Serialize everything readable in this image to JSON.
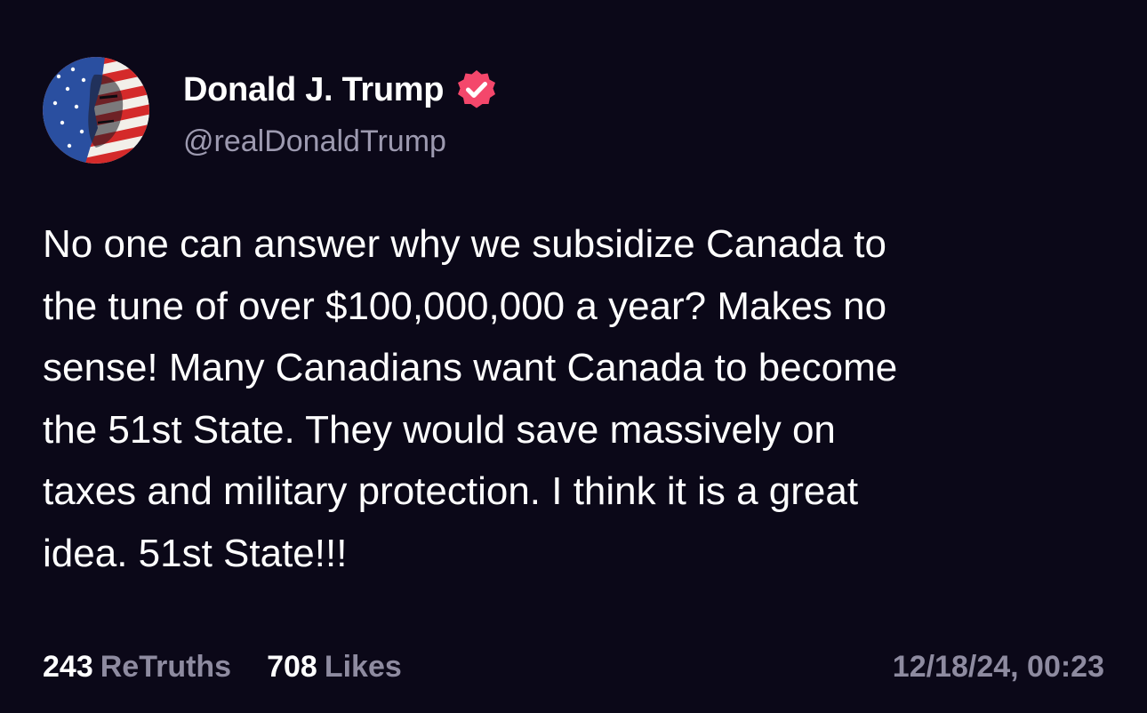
{
  "author": {
    "display_name": "Donald J. Trump",
    "handle": "@realDonaldTrump",
    "verified_icon": "verified-badge-icon",
    "avatar_icon": "profile-avatar"
  },
  "post": {
    "text": "No one can answer why we subsidize Canada to\nthe tune of over $100,000,000 a year? Makes no\nsense! Many Canadians want Canada to become\nthe 51st State. They would save massively on\ntaxes and military protection. I think it is a great\nidea. 51st State!!!"
  },
  "stats": {
    "retruths_count": "243",
    "retruths_label": "ReTruths",
    "likes_count": "708",
    "likes_label": "Likes"
  },
  "timestamp": "12/18/24, 00:23",
  "colors": {
    "background": "#0b0818",
    "badge": "#f4476b",
    "muted_text": "#8e8ba0"
  }
}
